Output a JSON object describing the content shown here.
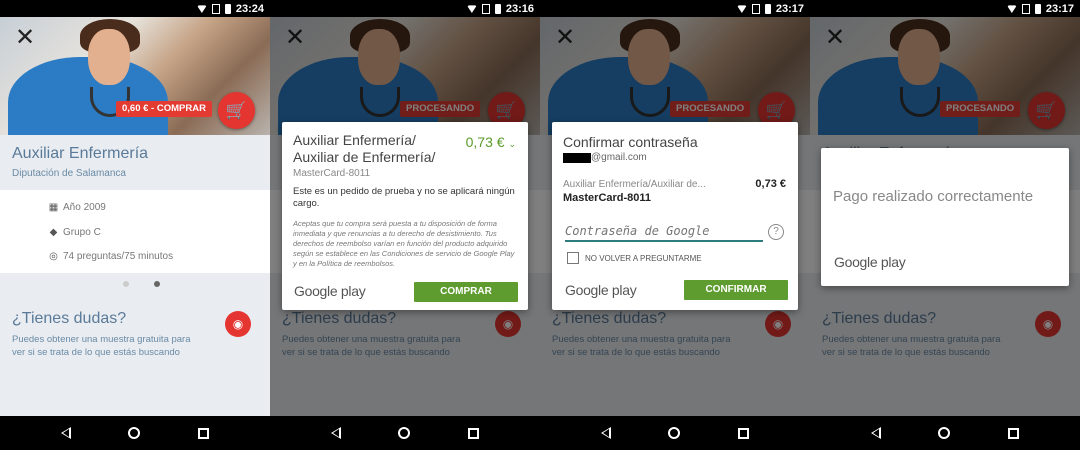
{
  "status": {
    "time_1": "23:24",
    "time_2": "23:16",
    "time_3": "23:17",
    "time_4": "23:17"
  },
  "product": {
    "buy_label": "0,60 € - COMPRAR",
    "processing_label": "PROCESANDO",
    "title": "Auxiliar Enfermería",
    "subtitle": "Diputación de Salamanca",
    "info": [
      {
        "icon": "calendar-icon",
        "text": "Año 2009"
      },
      {
        "icon": "tag-icon",
        "text": "Grupo C"
      },
      {
        "icon": "watch-icon",
        "text": "74 preguntas/75 minutos"
      }
    ],
    "doubts_title": "¿Tienes dudas?",
    "doubts_text": "Puedes obtener una muestra gratuita para ver si se trata de lo que estás buscando"
  },
  "purchase_dialog": {
    "title": "Auxiliar Enfermería/ Auxiliar de Enfermería/",
    "price": "0,73 €",
    "card": "MasterCard-8011",
    "test_notice": "Este es un pedido de prueba y no se aplicará ningún cargo.",
    "legal": "Aceptas que tu compra será puesta a tu disposición de forma inmediata y que renuncias a tu derecho de desistimiento. Tus derechos de reembolso varían en función del producto adquirido según se establece en las Condiciones de servicio de Google Play y en la Política de reembolsos.",
    "brand": "Google play",
    "button": "COMPRAR"
  },
  "password_dialog": {
    "title": "Confirmar contraseña",
    "email_suffix": "@gmail.com",
    "item": "Auxiliar Enfermería/Auxiliar de...",
    "price": "0,73 €",
    "card": "MasterCard-8011",
    "password_placeholder": "Contraseña de Google",
    "checkbox_label": "NO VOLVER A PREGUNTARME",
    "brand": "Google play",
    "button": "CONFIRMAR"
  },
  "success_dialog": {
    "message": "Pago realizado correctamente",
    "brand": "Google play"
  }
}
